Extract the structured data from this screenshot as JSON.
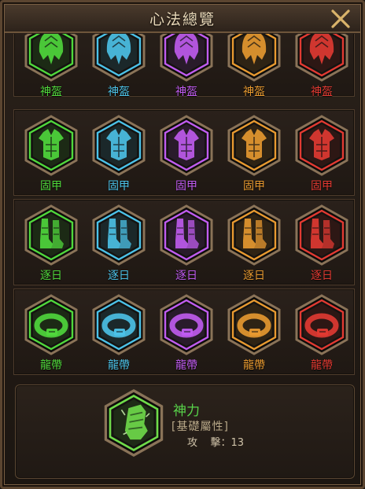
{
  "window": {
    "title": "心法總覽"
  },
  "rows": [
    {
      "label": "神盔",
      "icon": "helmet-icon",
      "cells": [
        {
          "color": "#50d83c"
        },
        {
          "color": "#4cc2e8"
        },
        {
          "color": "#c05cf0"
        },
        {
          "color": "#e89a30"
        },
        {
          "color": "#e23a32"
        }
      ]
    },
    {
      "label": "固甲",
      "icon": "armor-icon",
      "cells": [
        {
          "color": "#50d83c"
        },
        {
          "color": "#4cc2e8"
        },
        {
          "color": "#c05cf0"
        },
        {
          "color": "#e89a30"
        },
        {
          "color": "#e23a32"
        }
      ]
    },
    {
      "label": "逐日",
      "icon": "boots-icon",
      "cells": [
        {
          "color": "#50d83c"
        },
        {
          "color": "#4cc2e8"
        },
        {
          "color": "#c05cf0"
        },
        {
          "color": "#e89a30"
        },
        {
          "color": "#e23a32"
        }
      ]
    },
    {
      "label": "龍帶",
      "icon": "belt-icon",
      "cells": [
        {
          "color": "#50d83c"
        },
        {
          "color": "#4cc2e8"
        },
        {
          "color": "#c05cf0"
        },
        {
          "color": "#e89a30"
        },
        {
          "color": "#e23a32"
        }
      ]
    }
  ],
  "detail": {
    "name": "神力",
    "category": "[基礎屬性]",
    "stat_text": "攻    擊：13",
    "icon": "fist-icon",
    "color": "#6fdc4a"
  },
  "colors": {
    "accent": "#d9b36a",
    "border": "#6e553b"
  }
}
